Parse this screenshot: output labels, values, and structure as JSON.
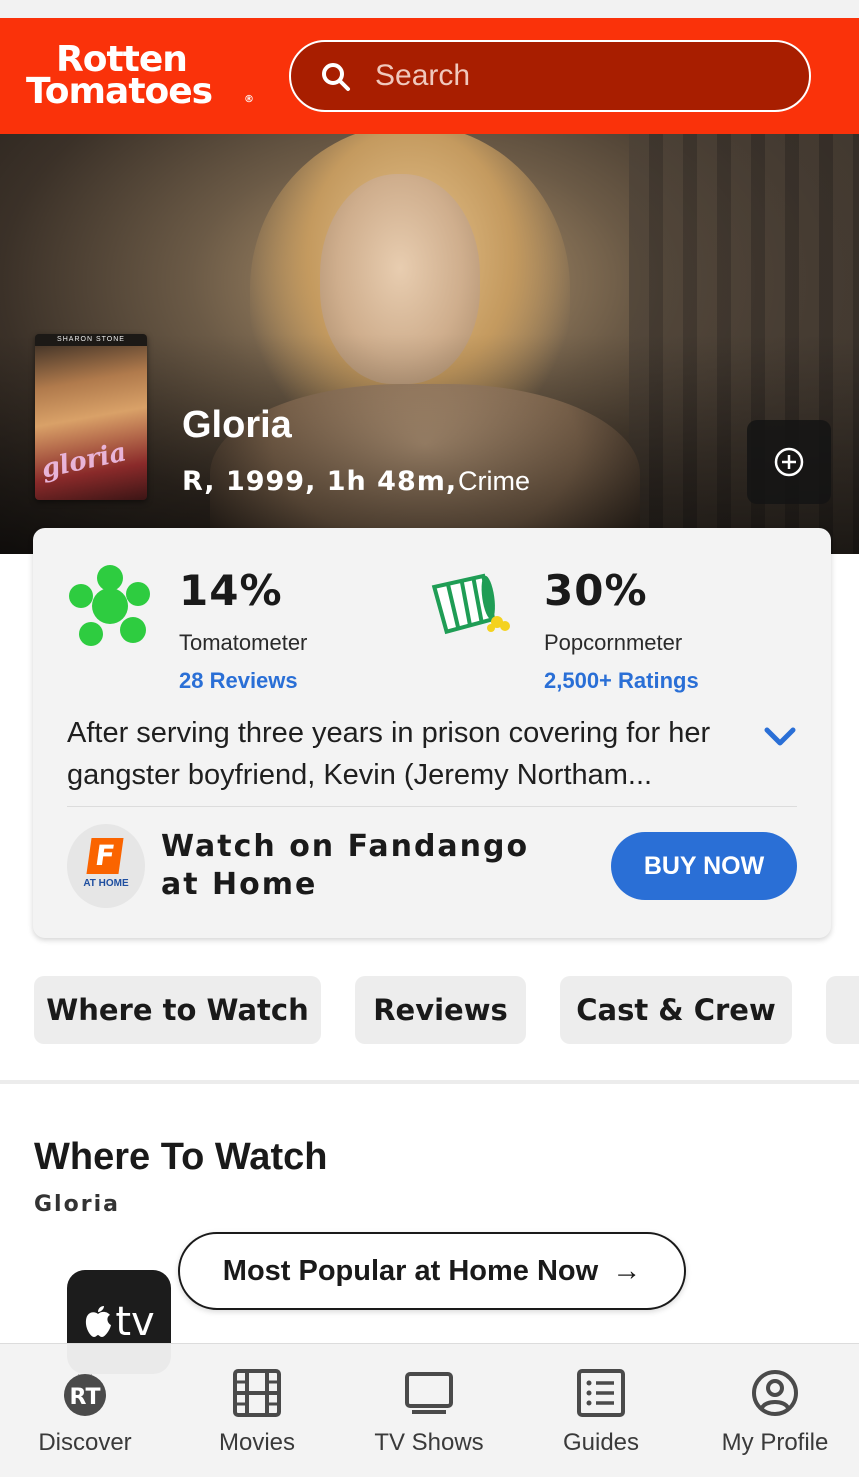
{
  "header": {
    "logo_line1": "Rotten",
    "logo_line2": "Tomatoes",
    "logo_mark": "®",
    "search_placeholder": "Search",
    "search_icon": "search-icon",
    "brand_color": "#fa320a"
  },
  "movie": {
    "title": "Gloria",
    "meta": "R, 1999, 1h 48m,",
    "genre": "Crime",
    "poster_top_text": "SHARON STONE",
    "poster_title": "gloria",
    "add_icon": "plus-circle-icon"
  },
  "scores": {
    "tomatometer": {
      "value": "14%",
      "label": "Tomatometer",
      "link": "28 Reviews",
      "icon": "splat-icon",
      "color": "#2ecc40"
    },
    "popcornmeter": {
      "value": "30%",
      "label": "Popcornmeter",
      "link": "2,500+ Ratings",
      "icon": "spilled-popcorn-icon",
      "color": "#1f9d55"
    }
  },
  "synopsis": "After serving three years in prison covering for her gangster boyfriend, Kevin (Jeremy Northam...",
  "fandango": {
    "icon_letter": "F",
    "icon_caption": "AT HOME",
    "text": "Watch on Fandango at Home",
    "button": "BUY NOW",
    "button_color": "#2a6fd6"
  },
  "tabs": [
    "Where to Watch",
    "Reviews",
    "Cast & Crew"
  ],
  "where_to_watch": {
    "title": "Where To Watch",
    "subtitle": "Gloria",
    "provider": "tv",
    "popular_button": "Most Popular at Home Now",
    "popular_arrow": "→"
  },
  "bottom_nav": [
    {
      "label": "Discover",
      "icon": "rt-logo-icon"
    },
    {
      "label": "Movies",
      "icon": "film-icon"
    },
    {
      "label": "TV Shows",
      "icon": "tv-icon"
    },
    {
      "label": "Guides",
      "icon": "list-icon"
    },
    {
      "label": "My Profile",
      "icon": "profile-icon"
    }
  ]
}
